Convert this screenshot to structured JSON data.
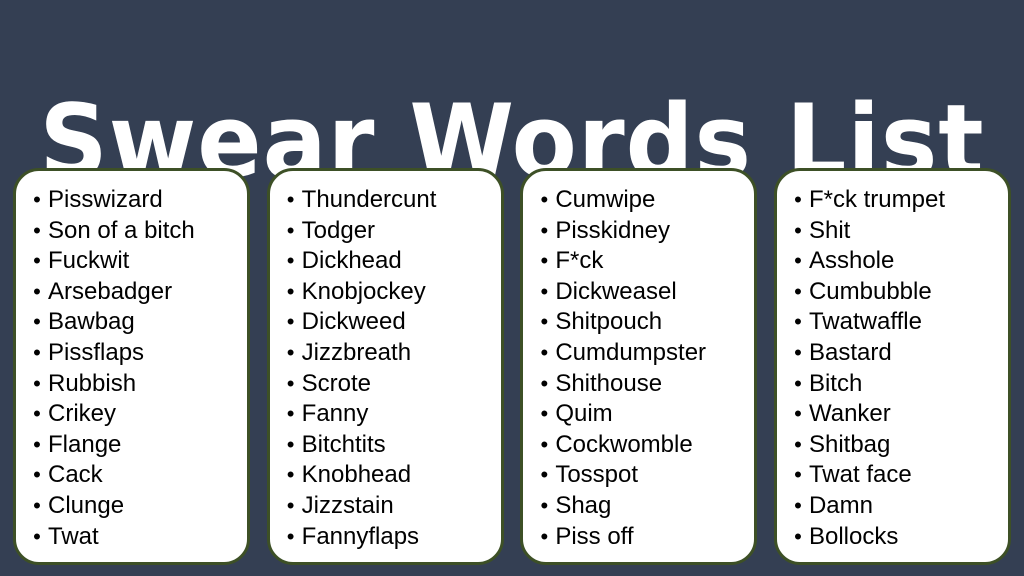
{
  "page": {
    "title": "Swear Words List",
    "background_color": "#343f53",
    "title_color": "#ffffff",
    "card_background_color": "#ffffff",
    "card_border_color": "#3d5026",
    "text_color": "#010101",
    "bullet_glyph": "•"
  },
  "columns": [
    {
      "name": "column-1",
      "items": [
        {
          "label": "Pisswizard"
        },
        {
          "label": "Son of a bitch"
        },
        {
          "label": "Fuckwit"
        },
        {
          "label": "Arsebadger"
        },
        {
          "label": "Bawbag"
        },
        {
          "label": "Pissflaps"
        },
        {
          "label": "Rubbish"
        },
        {
          "label": "Crikey"
        },
        {
          "label": "Flange"
        },
        {
          "label": "Cack"
        },
        {
          "label": "Clunge"
        },
        {
          "label": "Twat"
        }
      ]
    },
    {
      "name": "column-2",
      "items": [
        {
          "label": "Thundercunt"
        },
        {
          "label": "Todger"
        },
        {
          "label": "Dickhead"
        },
        {
          "label": "Knobjockey"
        },
        {
          "label": "Dickweed"
        },
        {
          "label": "Jizzbreath"
        },
        {
          "label": "Scrote"
        },
        {
          "label": "Fanny"
        },
        {
          "label": "Bitchtits"
        },
        {
          "label": "Knobhead"
        },
        {
          "label": "Jizzstain"
        },
        {
          "label": "Fannyflaps"
        }
      ]
    },
    {
      "name": "column-3",
      "items": [
        {
          "label": "Cumwipe"
        },
        {
          "label": "Pisskidney"
        },
        {
          "label": "F*ck"
        },
        {
          "label": "Dickweasel"
        },
        {
          "label": "Shitpouch"
        },
        {
          "label": "Cumdumpster"
        },
        {
          "label": "Shithouse"
        },
        {
          "label": "Quim"
        },
        {
          "label": "Cockwomble"
        },
        {
          "label": "Tosspot"
        },
        {
          "label": "Shag"
        },
        {
          "label": "Piss off"
        }
      ]
    },
    {
      "name": "column-4",
      "items": [
        {
          "label": "F*ck trumpet"
        },
        {
          "label": "Shit"
        },
        {
          "label": "Asshole"
        },
        {
          "label": "Cumbubble"
        },
        {
          "label": "Twatwaffle"
        },
        {
          "label": "Bastard"
        },
        {
          "label": "Bitch"
        },
        {
          "label": "Wanker"
        },
        {
          "label": "Shitbag"
        },
        {
          "label": "Twat face"
        },
        {
          "label": "Damn"
        },
        {
          "label": "Bollocks"
        }
      ]
    }
  ]
}
